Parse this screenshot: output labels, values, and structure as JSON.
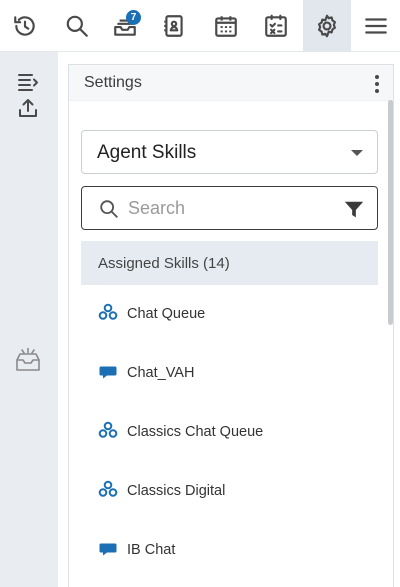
{
  "toolbar": {
    "buttons": [
      {
        "name": "history",
        "icon": "history-icon"
      },
      {
        "name": "search",
        "icon": "search-icon"
      },
      {
        "name": "inbox",
        "icon": "inbox-stack-icon",
        "badge": "7"
      },
      {
        "name": "contacts",
        "icon": "contact-book-icon"
      },
      {
        "name": "calendar",
        "icon": "calendar-icon"
      },
      {
        "name": "dispositions",
        "icon": "checklist-icon"
      },
      {
        "name": "settings",
        "icon": "gear-icon",
        "active": true
      },
      {
        "name": "menu",
        "icon": "hamburger-menu-icon"
      }
    ]
  },
  "rail": {
    "icons": [
      "collapse-panel-icon",
      "upload-icon",
      "empty-inbox-icon"
    ]
  },
  "panel": {
    "title": "Settings",
    "select": {
      "value": "Agent Skills"
    },
    "search": {
      "placeholder": "Search",
      "value": ""
    },
    "section": {
      "label": "Assigned Skills (14)"
    },
    "skills": [
      {
        "label": "Chat Queue",
        "icon": "queue-icon"
      },
      {
        "label": "Chat_VAH",
        "icon": "chat-bubble-icon"
      },
      {
        "label": "Classics Chat Queue",
        "icon": "queue-icon"
      },
      {
        "label": "Classics Digital",
        "icon": "queue-icon"
      },
      {
        "label": "IB Chat",
        "icon": "chat-bubble-icon"
      }
    ]
  },
  "colors": {
    "accent": "#1a6fb5",
    "icon": "#4a4a4a",
    "rail": "#e9ecf0",
    "section_bg": "#e6ebf2",
    "active_tab": "#e2e7ee"
  }
}
